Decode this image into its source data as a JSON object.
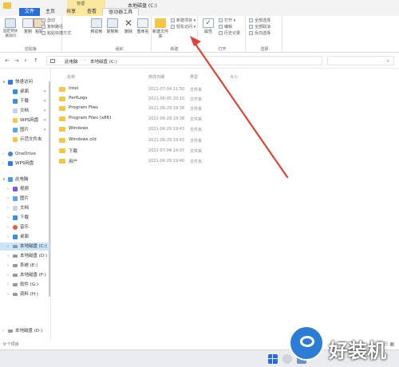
{
  "window": {
    "title": "本地磁盘 (C:)",
    "context_tab": "管理"
  },
  "tabs": [
    "文件",
    "主页",
    "共享",
    "查看",
    "驱动器工具"
  ],
  "ribbon": {
    "clipboard": {
      "group_label": "剪贴板",
      "pin_label": "固定到快速访问",
      "copy_label": "复制",
      "paste_label": "粘贴",
      "cut_label": "剪切",
      "copy_path_label": "复制路径",
      "paste_shortcut_label": "粘贴快捷方式"
    },
    "organize": {
      "group_label": "组织",
      "move_label": "移动到",
      "copy_to_label": "复制到",
      "delete_label": "删除",
      "rename_label": "重命名"
    },
    "new": {
      "group_label": "新建",
      "new_folder_label": "新建文件夹",
      "new_item_label": "新建项目",
      "easy_access_label": "轻松访问"
    },
    "open": {
      "group_label": "打开",
      "properties_label": "属性",
      "open_label": "打开",
      "edit_label": "编辑",
      "history_label": "历史记录"
    },
    "select": {
      "group_label": "选择",
      "select_all_label": "全部选择",
      "select_none_label": "全部取消",
      "invert_label": "反向选择"
    }
  },
  "address": {
    "crumbs": [
      "此电脑",
      "本地磁盘 (C:)"
    ]
  },
  "columns": {
    "name": "名称",
    "date": "修改日期",
    "type": "类型",
    "size": "大小"
  },
  "files": [
    {
      "name": "Intel",
      "date": "2021-07-04 11:50",
      "type": "文件夹"
    },
    {
      "name": "PerfLogs",
      "date": "2021-06-05 20:10",
      "type": "文件夹"
    },
    {
      "name": "Program Files",
      "date": "2021-06-29 19:38",
      "type": "文件夹"
    },
    {
      "name": "Program Files (x86)",
      "date": "2021-06-29 19:38",
      "type": "文件夹"
    },
    {
      "name": "Windows",
      "date": "2021-06-29 19:43",
      "type": "文件夹"
    },
    {
      "name": "Windows.old",
      "date": "2021-06-29 19:43",
      "type": "文件夹"
    },
    {
      "name": "下载",
      "date": "2021-07-04 14:07",
      "type": "文件夹"
    },
    {
      "name": "用户",
      "date": "2021-06-29 19:40",
      "type": "文件夹"
    }
  ],
  "nav": {
    "quick_access": "快速访问",
    "quick_items": [
      "桌面",
      "下载",
      "文档",
      "WPS网盘",
      "图片",
      "示范文件夹"
    ],
    "onedrive": "OneDrive",
    "wps": "WPS网盘",
    "this_pc": "此电脑",
    "pc_items": [
      "视频",
      "图片",
      "文档",
      "下载",
      "音乐",
      "桌面"
    ],
    "drives": [
      "本地磁盘 (C:)",
      "本地磁盘 (D:)",
      "系统 (E:)",
      "本地磁盘 (F:)",
      "软件 (G:)",
      "资料 (H:)"
    ],
    "network_drive": "本地磁盘 (D:)"
  },
  "status": {
    "count": "9 个项目"
  },
  "colors": {
    "accent": "#2b6fd1",
    "folder": "#f3c649",
    "arrow": "#d94536",
    "selected": "#cce4f7"
  },
  "watermark": {
    "text": "好装机"
  }
}
